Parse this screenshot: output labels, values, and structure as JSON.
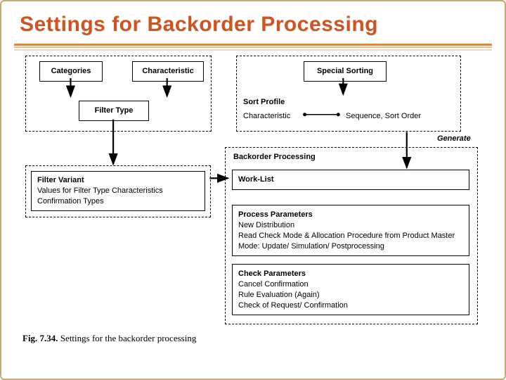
{
  "title": "Settings for Backorder Processing",
  "boxes": {
    "categories": "Categories",
    "characteristic": "Characteristic",
    "special_sorting": "Special Sorting",
    "filter_type": "Filter Type",
    "sort_profile": "Sort Profile",
    "sort_char": "Characteristic",
    "sort_seq": "Sequence, Sort Order",
    "generate": "Generate",
    "backorder_processing": "Backorder Processing",
    "work_list": "Work-List",
    "filter_variant_head": "Filter Variant",
    "filter_variant_line1": "Values for Filter Type Characteristics",
    "filter_variant_line2": "Confirmation Types",
    "process_head": "Process Parameters",
    "process_l1": "New Distribution",
    "process_l2": "Read Check Mode & Allocation Procedure from Product Master",
    "process_l3": "Mode: Update/ Simulation/ Postprocessing",
    "check_head": "Check Parameters",
    "check_l1": "Cancel Confirmation",
    "check_l2": "Rule Evaluation (Again)",
    "check_l3": "Check of Request/ Confirmation"
  },
  "caption_bold": "Fig. 7.34.",
  "caption_rest": " Settings for the backorder processing"
}
